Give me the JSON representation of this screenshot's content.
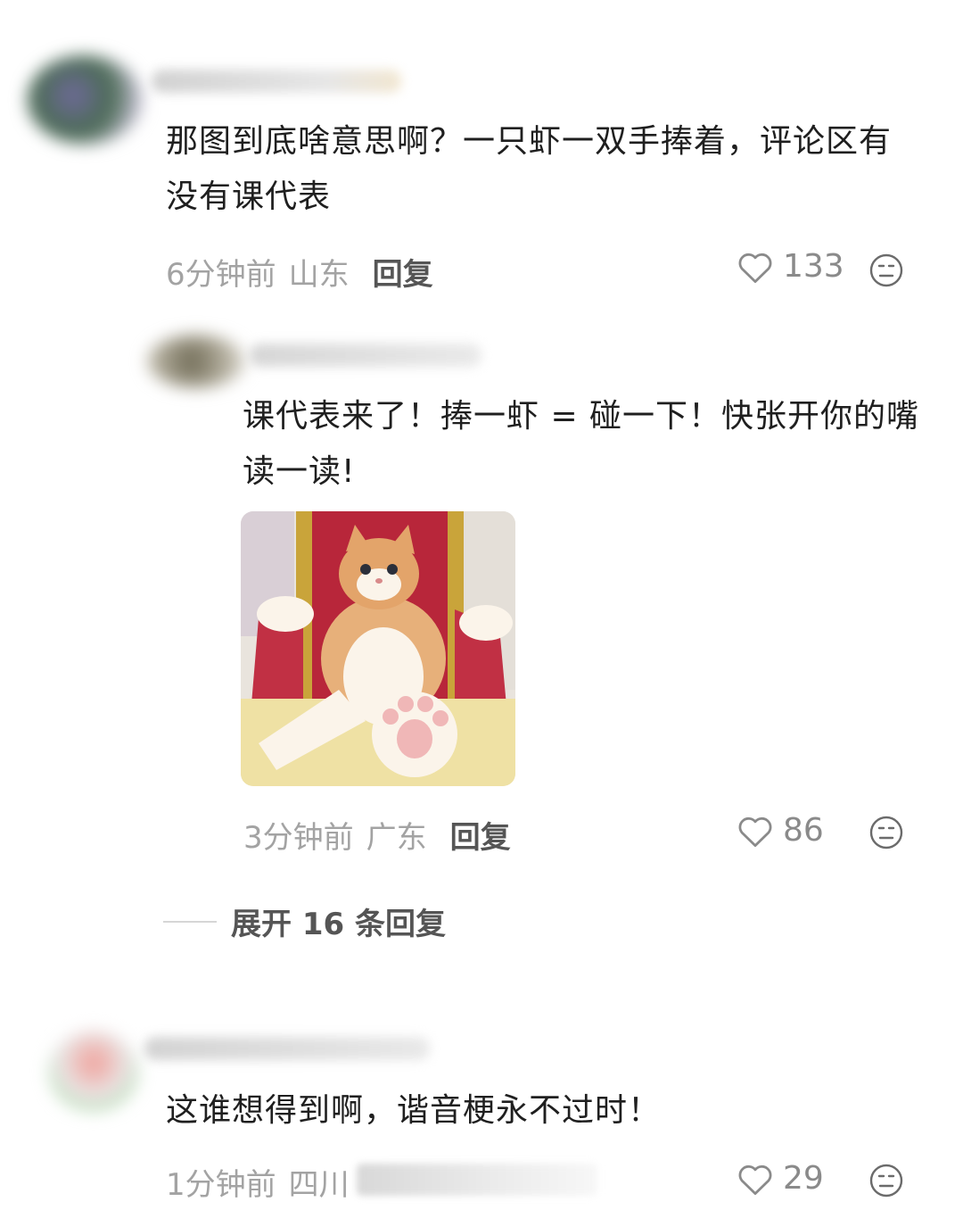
{
  "comments": [
    {
      "text": "那图到底啥意思啊？一只虾一双手捧着，评论区有没有课代表",
      "time": "6分钟前",
      "region": "山东",
      "reply_label": "回复",
      "likes": "133"
    },
    {
      "text": "课代表来了！捧一虾 = 碰一下！快张开你的嘴读一读!",
      "time": "3分钟前",
      "region": "广东",
      "reply_label": "回复",
      "likes": "86"
    },
    {
      "text": "这谁想得到啊，谐音梗永不过时！",
      "time": "1分钟前",
      "region": "四川",
      "likes": "29"
    }
  ],
  "expand_replies": "展开 16 条回复",
  "icons": {
    "like": "heart-outline-icon",
    "dislike": "neutral-face-icon"
  },
  "colors": {
    "meta": "#a3a3a3",
    "text": "#1f1f1f",
    "reply": "#555555"
  }
}
